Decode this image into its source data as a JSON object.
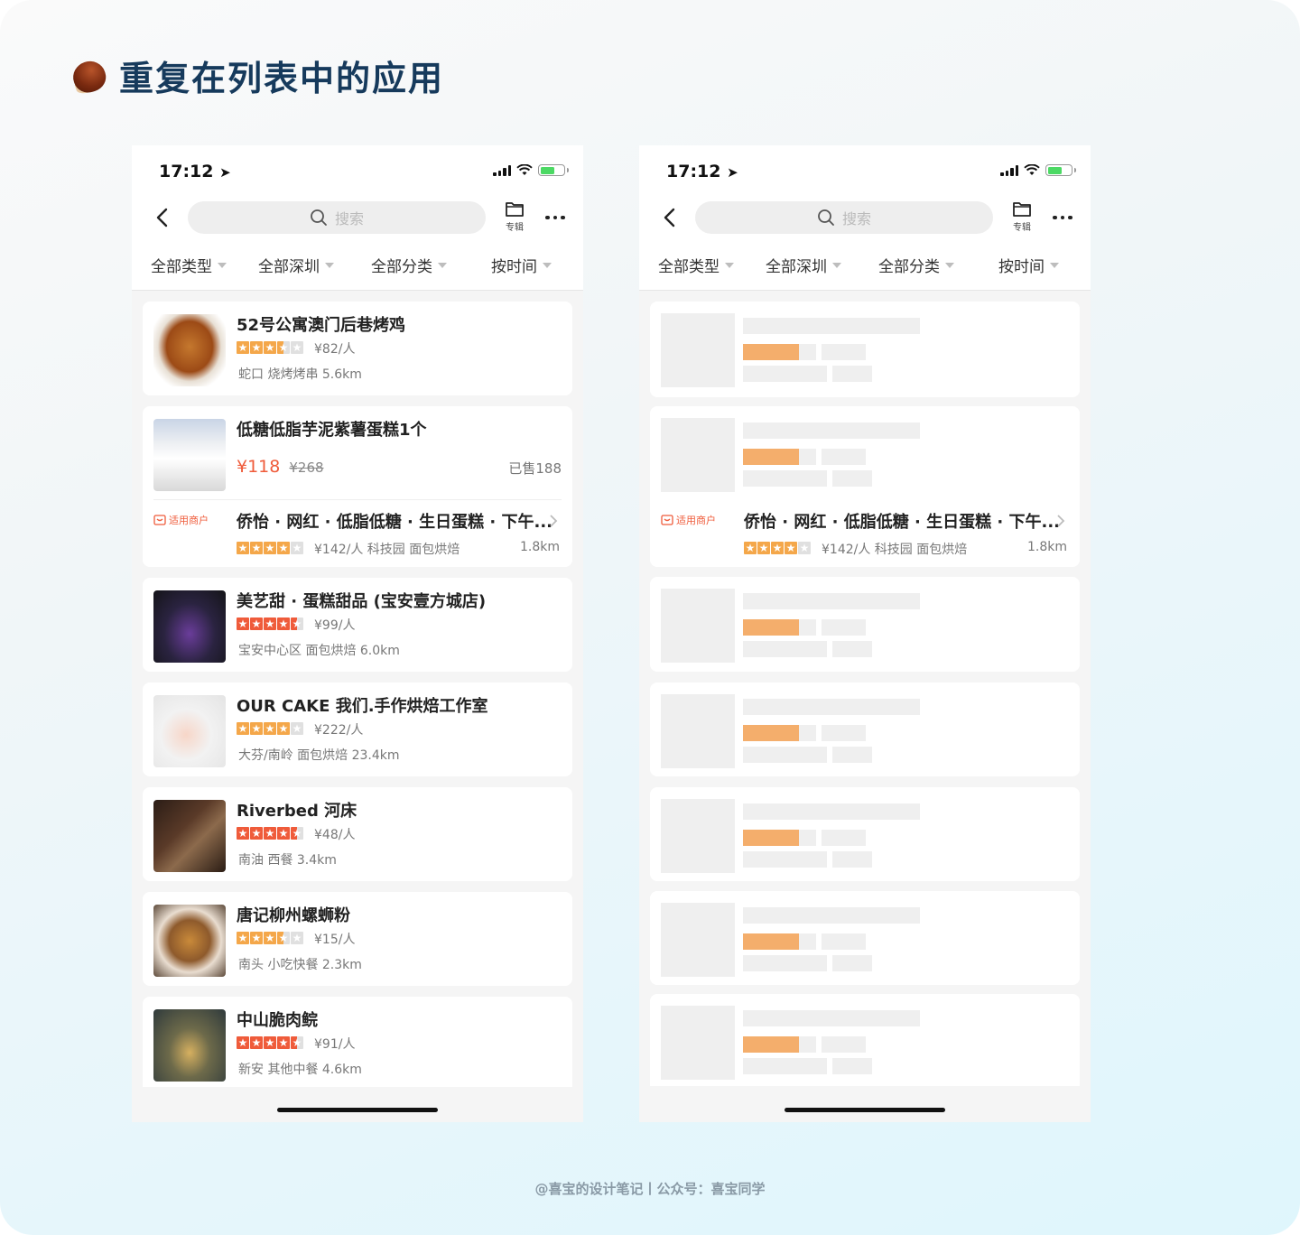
{
  "heading": {
    "icon": "chestnut-icon",
    "title": "重复在列表中的应用"
  },
  "phones": [
    {
      "status": {
        "time": "17:12"
      },
      "search": {
        "placeholder": "搜索"
      },
      "album_label": "专辑",
      "filters": [
        "全部类型",
        "全部深圳",
        "全部分类",
        "按时间"
      ],
      "items": [
        {
          "name": "52号公寓澳门后巷烤鸡",
          "rating": 3.5,
          "star_color": "orange",
          "price": "¥82/人",
          "meta": "蛇口 烧烤烤串  5.6km"
        },
        {
          "deal_name": "低糖低脂芋泥紫薯蛋糕1个",
          "deal_now": "¥118",
          "deal_old": "¥268",
          "sold": "已售188",
          "merchant_tag": "适用商户",
          "merchant_name": "侨怡 · 网红 · 低脂低糖 · 生日蛋糕 · 下午...",
          "merchant_rating": 4,
          "merchant_meta": "¥142/人 科技园 面包烘焙",
          "merchant_dist": "1.8km"
        },
        {
          "name": "美艺甜 · 蛋糕甜品 (宝安壹方城店)",
          "rating": 4.5,
          "star_color": "red",
          "price": "¥99/人",
          "meta": "宝安中心区 面包烘焙  6.0km"
        },
        {
          "name": "OUR CAKE 我们.手作烘焙工作室",
          "rating": 4,
          "star_color": "orange",
          "price": "¥222/人",
          "meta": "大芬/南岭 面包烘焙  23.4km"
        },
        {
          "name": "Riverbed 河床",
          "rating": 4.5,
          "star_color": "red",
          "price": "¥48/人",
          "meta": "南油 西餐  3.4km"
        },
        {
          "name": "唐记柳州螺蛳粉",
          "rating": 3.5,
          "star_color": "orange",
          "price": "¥15/人",
          "meta": "南头 小吃快餐  2.3km"
        },
        {
          "name": "中山脆肉鲩",
          "rating": 4.5,
          "star_color": "red",
          "price": "¥91/人",
          "meta": "新安 其他中餐  4.6km"
        }
      ]
    },
    {
      "status": {
        "time": "17:12"
      },
      "search": {
        "placeholder": "搜索"
      },
      "album_label": "专辑",
      "filters": [
        "全部类型",
        "全部深圳",
        "全部分类",
        "按时间"
      ],
      "skeleton_deal": {
        "merchant_tag": "适用商户",
        "merchant_name": "侨怡 · 网红 · 低脂低糖 · 生日蛋糕 · 下午...",
        "merchant_rating": 4,
        "merchant_meta": "¥142/人 科技园 面包烘焙",
        "merchant_dist": "1.8km"
      }
    }
  ],
  "footer": "@喜宝的设计笔记丨公众号：喜宝同学",
  "colors": {
    "accent": "#ef5b3a",
    "star_orange": "#f4a74a",
    "skeleton": "#efefef",
    "skeleton_accent": "#f4ae6c",
    "heading": "#163a5c"
  }
}
